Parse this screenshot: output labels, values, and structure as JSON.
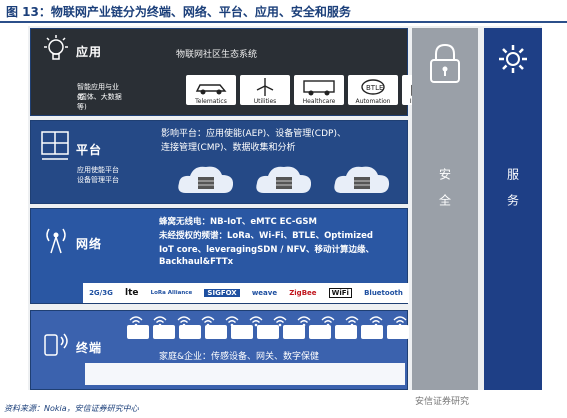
{
  "figure": {
    "title": "图 13：物联网产业链分为终端、网络、平台、应用、安全和服务"
  },
  "layers": {
    "application": {
      "name": "应用",
      "sub_line1": "智能应用与业务",
      "sub_line2": "(国体、大数据等)",
      "header": "物联网社区生态系统",
      "cards": [
        "Telematics",
        "Utilities",
        "Healthcare",
        "Automation",
        "Industrial"
      ]
    },
    "platform": {
      "name": "平台",
      "sub_line1": "应用使能平台",
      "sub_line2": "设备管理平台",
      "line1": "影响平台：应用使能(AEP)、设备管理(CDP)、",
      "line2": "连接管理(CMP)、数据收集和分析"
    },
    "network": {
      "name": "网络",
      "line1": "蜂窝无线电：NB-IoT、eMTC EC-GSM",
      "line2": "未经授权的频谱：LoRa、Wi-Fi、BTLE、Optimized",
      "line3": "IoT core、leveragingSDN / NFV、移动计算边缘、",
      "line4": "Backhaul&FTTx",
      "tech": [
        "2G/3G",
        "lte",
        "LoRa Alliance",
        "SIGFOX",
        "weave",
        "ZigBee",
        "WiFi",
        "Bluetooth"
      ]
    },
    "terminal": {
      "name": "终端",
      "line1": "家庭&企业：传感设备、网关、数字保健"
    }
  },
  "pillars": {
    "security": "安全",
    "service": "服务"
  },
  "source": "资料来源：Nokia，安信证券研究中心",
  "watermark": "安信证券研究",
  "colors": {
    "title": "#1b3f7a",
    "app_bg": "#2a2f35",
    "platform_bg": "#254986",
    "network_bg": "#2a57a3",
    "terminal_bg": "#3b62ae",
    "security_bg": "#9aa0a8",
    "service_bg": "#1e3f86"
  }
}
